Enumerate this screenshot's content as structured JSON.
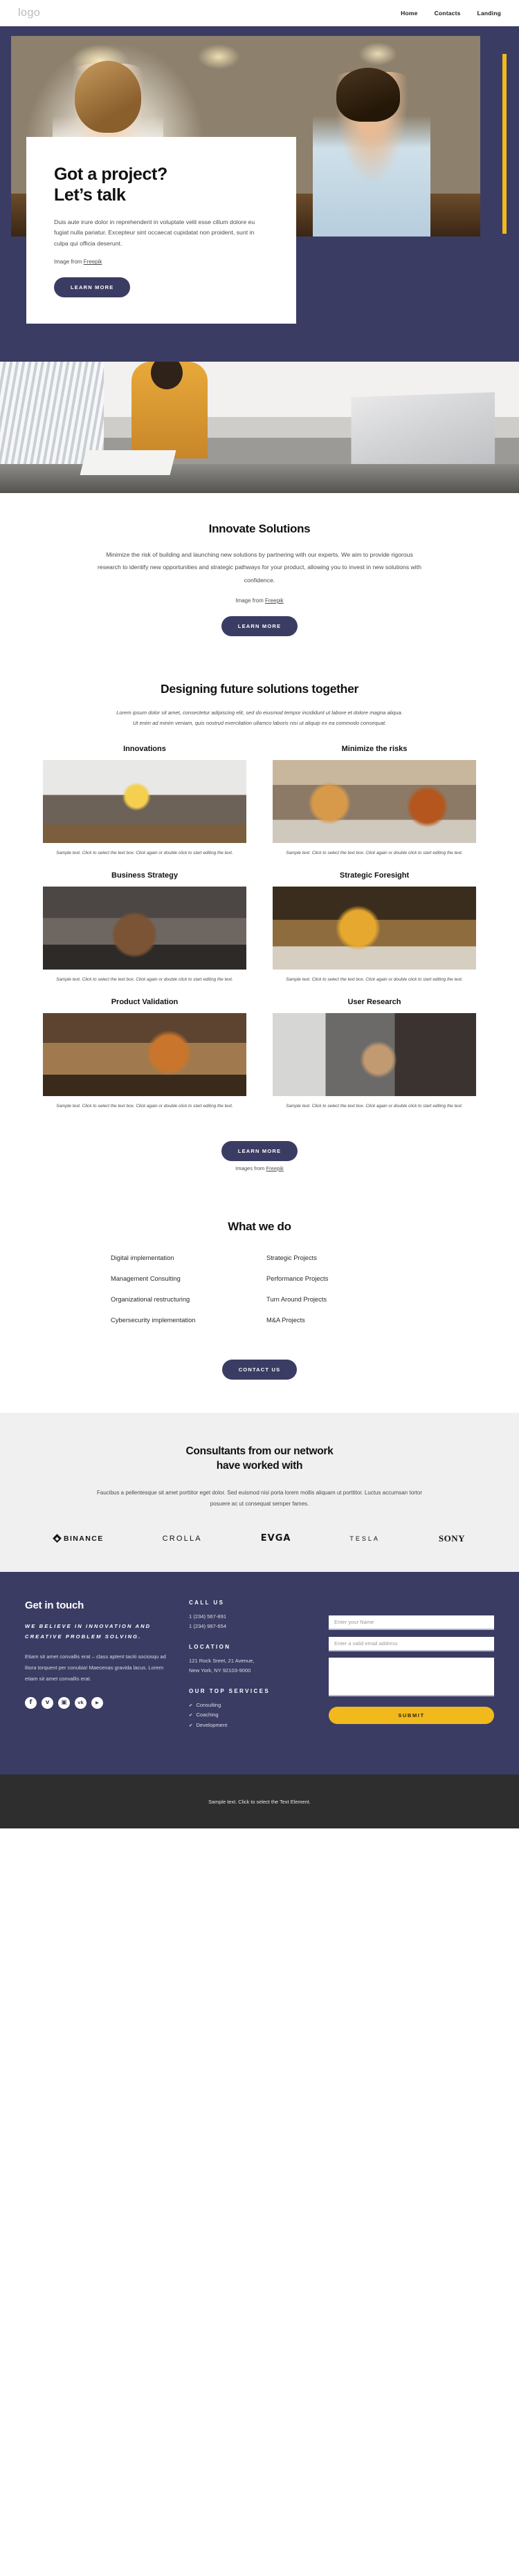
{
  "nav": {
    "logo": "logo",
    "links": [
      {
        "label": "Home"
      },
      {
        "label": "Contacts"
      },
      {
        "label": "Landing"
      }
    ]
  },
  "hero": {
    "title_line1": "Got a project?",
    "title_line2": "Let’s talk",
    "body": "Duis aute irure dolor in reprehenderit in voluptate velit esse cillum dolore eu fugiat nulla pariatur. Excepteur sint occaecat cupidatat non proident, sunt in culpa qui officia deserunt.",
    "credit_prefix": "Image from ",
    "credit_link": "Freepik",
    "cta": "LEARN MORE"
  },
  "innovate": {
    "title": "Innovate Solutions",
    "body": "Minimize the risk of building and launching new solutions by partnering with our experts. We aim to provide rigorous research to identify new opportunities and strategic pathways for your product, allowing you to invest in new solutions with confidence.",
    "credit_prefix": "Image from ",
    "credit_link": "Freepik",
    "cta": "LEARN MORE"
  },
  "designing": {
    "title": "Designing future solutions together",
    "lead": "Lorem ipsum dolor sit amet, consectetur adipiscing elit, sed do eiusmod tempor incididunt ut labore et dolore magna aliqua. Ut enim ad minim veniam, quis nostrud exercitation ullamco laboris nisi ut aliquip ex ea commodo consequat.",
    "caption": "Sample text. Click to select the text box. Click again or double click to start editing the text.",
    "cards": [
      {
        "title": "Innovations"
      },
      {
        "title": "Minimize the risks"
      },
      {
        "title": "Business Strategy"
      },
      {
        "title": "Strategic Foresight"
      },
      {
        "title": "Product Validation"
      },
      {
        "title": "User Research"
      }
    ],
    "cta": "LEARN MORE",
    "credit_prefix": "Images from ",
    "credit_link": "Freepik"
  },
  "whatwedo": {
    "title": "What we do",
    "items_left": [
      "Digital implementation",
      "Management Consulting",
      "Organizational restructuring",
      "Cybersecurity implementation"
    ],
    "items_right": [
      "Strategic Projects",
      "Performance Projects",
      "Turn Around Projects",
      "M&A Projects"
    ],
    "cta": "CONTACT US"
  },
  "consultants": {
    "title_line1": "Consultants from our network",
    "title_line2": "have worked with",
    "body": "Faucibus a pellentesque sit amet porttitor eget dolor. Sed euismod nisi porta lorem mollis aliquam ut porttitor. Luctus accumsan tortor posuere ac ut consequat semper fames.",
    "logos": [
      {
        "name": "BINANCE"
      },
      {
        "name": "CROLLA"
      },
      {
        "name": "EVGA"
      },
      {
        "name": "TESLA"
      },
      {
        "name": "SONY"
      }
    ]
  },
  "footer": {
    "title": "Get in touch",
    "slogan": "WE BELIEVE IN INNOVATION AND CREATIVE PROBLEM SOLVING.",
    "text": "Etiam sit amet convallis erat – class aptent taciti sociosqu ad litora torquent per conubia! Maecenas gravida lacus. Lorem etiam sit amet convallis erat.",
    "socials": [
      {
        "icon": "facebook-icon",
        "glyph": "f"
      },
      {
        "icon": "twitter-icon",
        "glyph": "ᴠ"
      },
      {
        "icon": "instagram-icon",
        "glyph": "▣"
      },
      {
        "icon": "vk-icon",
        "glyph": "vk"
      },
      {
        "icon": "youtube-icon",
        "glyph": "▶"
      }
    ],
    "call_us_head": "CALL US",
    "phones": [
      "1 (234) 567-891",
      "1 (234) 987-654"
    ],
    "location_head": "LOCATION",
    "address_line1": "121 Rock Sreet, 21 Avenue,",
    "address_line2": "New York, NY 92103-9000",
    "services_head": "OUR TOP SERVICES",
    "services": [
      "Consulting",
      "Coaching",
      "Development"
    ],
    "form": {
      "name_placeholder": "Enter your Name",
      "email_placeholder": "Enter a valid email address",
      "message_placeholder": "",
      "submit": "SUBMIT"
    }
  },
  "bottom": {
    "text": "Sample text. Click to select the Text Element."
  }
}
